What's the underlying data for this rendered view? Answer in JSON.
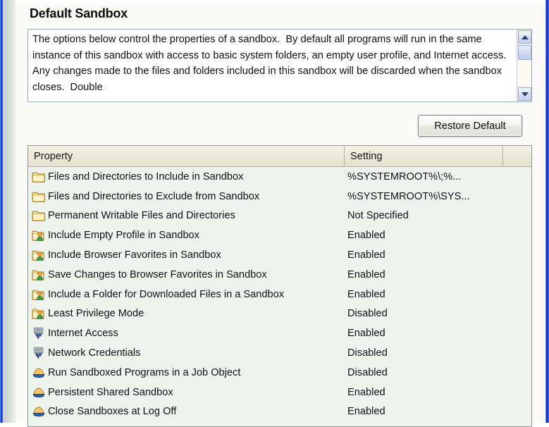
{
  "window": {
    "accent_border_color": "#1c45d8",
    "page_background": "#fafaf8"
  },
  "page_title": "Default Sandbox",
  "description": {
    "text": "The options below control the properties of a sandbox.  By default all programs will run in the same instance of this sandbox with access to basic system folders, an empty user profile, and Internet access.  Any changes made to the files and folders included in this sandbox will be discarded when the sandbox closes.  Double",
    "scrollbar": {
      "up_icon": "chevron-up-icon",
      "down_icon": "chevron-down-icon"
    }
  },
  "toolbar": {
    "restore_default_label": "Restore Default"
  },
  "property_list": {
    "columns": [
      "Property",
      "Setting",
      ""
    ],
    "rows": [
      {
        "icon": "folder-icon",
        "property": "Files and Directories to Include in Sandbox",
        "setting": "%SYSTEMROOT%\\;%..."
      },
      {
        "icon": "folder-icon",
        "property": "Files and Directories to Exclude from Sandbox",
        "setting": "%SYSTEMROOT%\\SYS..."
      },
      {
        "icon": "folder-icon",
        "property": "Permanent Writable Files and Directories",
        "setting": "Not Specified"
      },
      {
        "icon": "folder-user-icon",
        "property": "Include Empty Profile in Sandbox",
        "setting": "Enabled"
      },
      {
        "icon": "folder-user-icon",
        "property": "Include Browser Favorites in Sandbox",
        "setting": "Enabled"
      },
      {
        "icon": "folder-user-icon",
        "property": "Save Changes to Browser Favorites in Sandbox",
        "setting": "Enabled"
      },
      {
        "icon": "folder-user-icon",
        "property": "Include a Folder for Downloaded Files in a Sandbox",
        "setting": "Enabled"
      },
      {
        "icon": "folder-user-icon",
        "property": "Least Privilege Mode",
        "setting": "Disabled"
      },
      {
        "icon": "network-icon",
        "property": "Internet Access",
        "setting": "Enabled"
      },
      {
        "icon": "network-icon",
        "property": "Network Credentials",
        "setting": "Disabled"
      },
      {
        "icon": "sandbox-icon",
        "property": "Run Sandboxed Programs in a Job Object",
        "setting": "Disabled"
      },
      {
        "icon": "sandbox-icon",
        "property": "Persistent Shared Sandbox",
        "setting": "Enabled"
      },
      {
        "icon": "sandbox-icon",
        "property": "Close Sandboxes at Log Off",
        "setting": "Enabled"
      }
    ]
  }
}
